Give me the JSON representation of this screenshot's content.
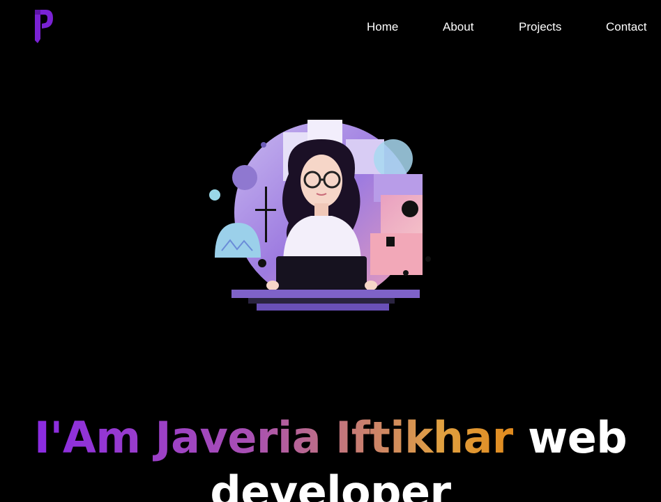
{
  "header": {
    "logo_icon": "p-letter-logo",
    "nav": [
      {
        "label": "Home"
      },
      {
        "label": "About"
      },
      {
        "label": "Projects"
      },
      {
        "label": "Contact"
      }
    ]
  },
  "hero": {
    "illustration_icon": "woman-with-laptop-illustration",
    "name_part": "I'Am Javeria Iftikhar",
    "role_part": "web developer"
  },
  "colors": {
    "background": "#000000",
    "text": "#ffffff",
    "logo": "#7a22d4",
    "gradient_start": "#8a2be2",
    "gradient_end": "#e08a1e"
  }
}
